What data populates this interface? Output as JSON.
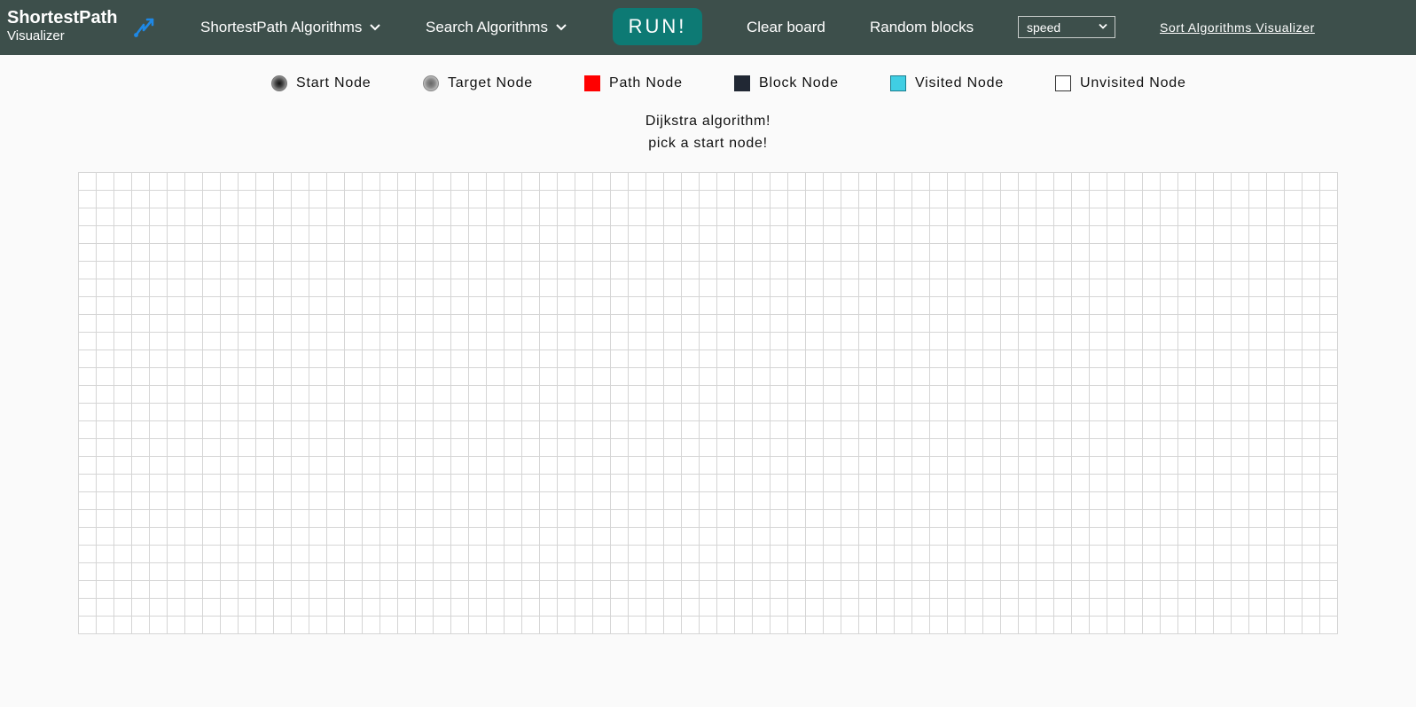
{
  "navbar": {
    "brand_title": "ShortestPath",
    "brand_subtitle": "Visualizer",
    "brand_icon": "route-arrows-icon",
    "menu_shortest": "ShortestPath Algorithms",
    "menu_search": "Search Algorithms",
    "run_label": "RUN!",
    "clear_label": "Clear board",
    "random_label": "Random blocks",
    "speed_selected": "speed",
    "sort_link": "Sort Algorithms Visualizer"
  },
  "legend": {
    "start": "Start Node",
    "target": "Target Node",
    "path": "Path Node",
    "block": "Block Node",
    "visited": "Visited Node",
    "unvisited": "Unvisited Node"
  },
  "status": {
    "line1": "Dijkstra algorithm!",
    "line2": "pick a start node!"
  },
  "colors": {
    "navbar": "#3d4f4b",
    "run_button": "#0d7a74",
    "path": "#ff0000",
    "block": "#212834",
    "visited": "#40cee3",
    "unvisited": "#ffffff"
  },
  "grid": {
    "rows": 26,
    "cols": 71
  }
}
